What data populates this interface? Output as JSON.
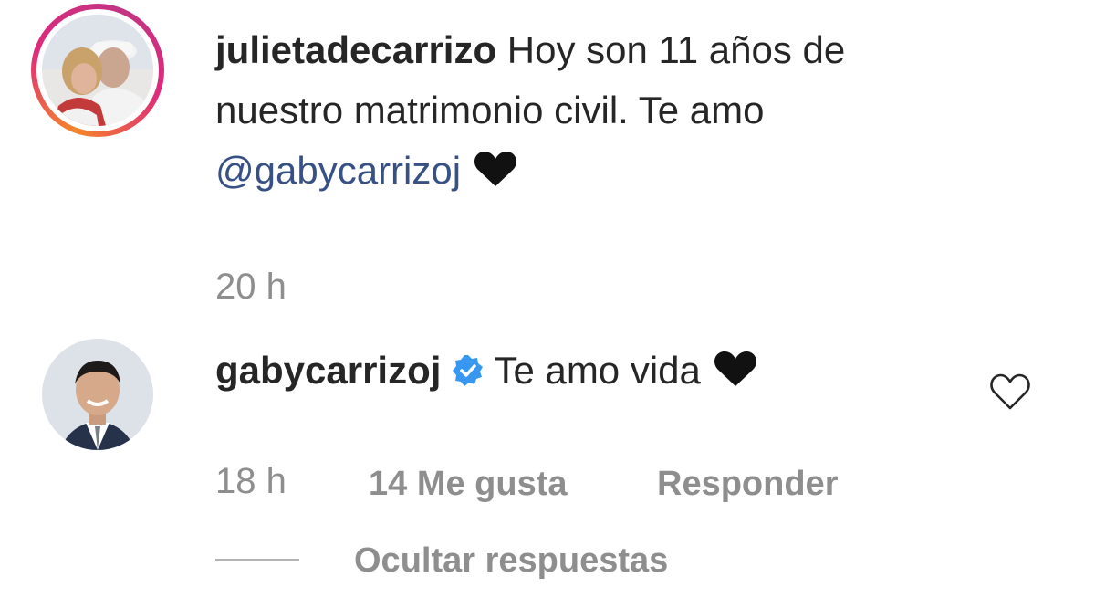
{
  "comments": [
    {
      "username": "julietadecarrizo",
      "text": "Hoy son 11 años de",
      "text_line2": "nuestro matrimonio civil. Te amo",
      "mention": "@gabycarrizoj",
      "emoji": "black-heart-emoji",
      "time": "20 h"
    },
    {
      "username": "gabycarrizoj",
      "verified": true,
      "text": "Te amo vida",
      "emoji": "black-heart-emoji",
      "time": "18 h",
      "likes": "14 Me gusta",
      "reply_label": "Responder",
      "hide_replies_label": "Ocultar respuestas"
    }
  ],
  "colors": {
    "text": "#262626",
    "muted": "#8e8e8e",
    "mention": "#385185",
    "verified": "#3897f0",
    "story_ring_start": "#f58529",
    "story_ring_end": "#dd2a7b"
  }
}
